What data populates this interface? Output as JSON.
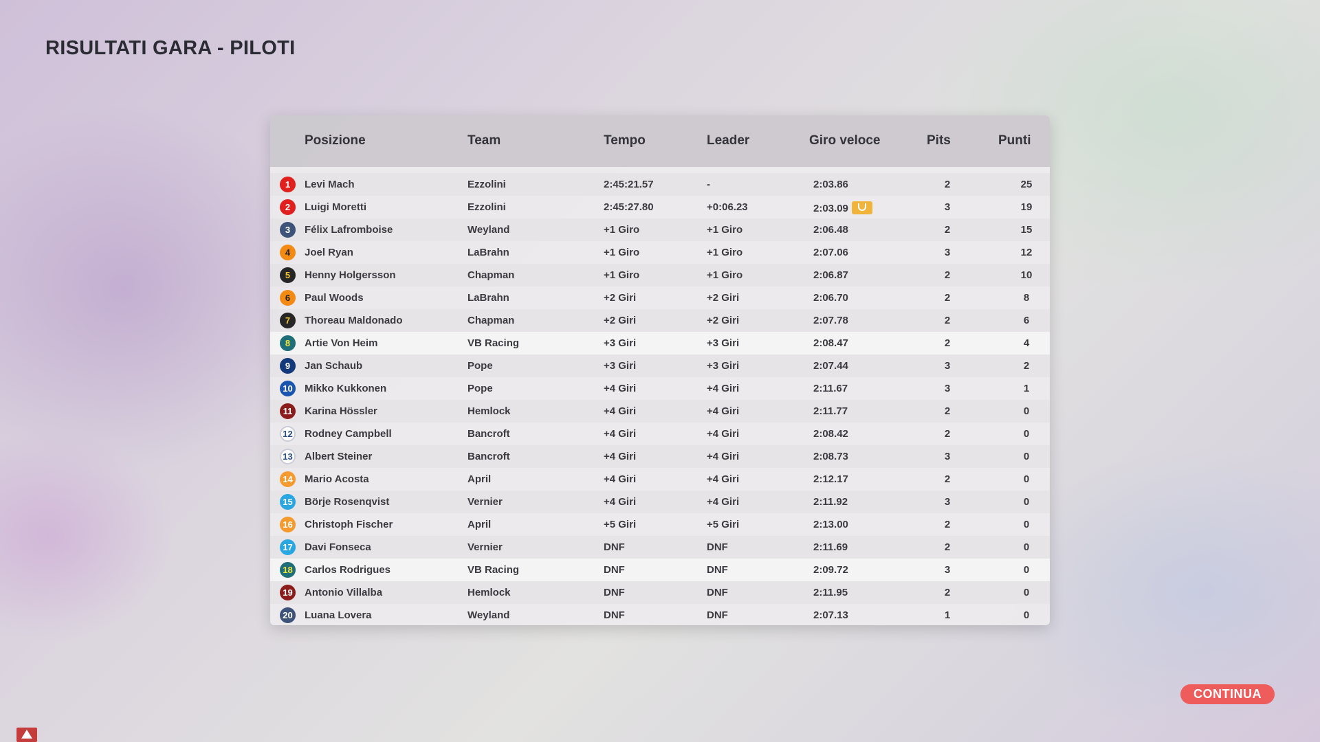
{
  "page": {
    "title": "RISULTATI GARA - PILOTI"
  },
  "table": {
    "headers": {
      "position": "Posizione",
      "team": "Team",
      "time": "Tempo",
      "leader": "Leader",
      "fastest_lap": "Giro veloce",
      "pits": "Pits",
      "points": "Punti"
    },
    "highlighted_rows": [
      8,
      18
    ],
    "rows": [
      {
        "pos": "1",
        "name": "Levi Mach",
        "team": "Ezzolini",
        "time": "2:45:21.57",
        "leader": "-",
        "fastest": "2:03.86",
        "pits": "2",
        "points": "25",
        "badge_bg": "#e0201e",
        "badge_fg": "#ffffff",
        "badge_border": "#e0201e"
      },
      {
        "pos": "2",
        "name": "Luigi Moretti",
        "team": "Ezzolini",
        "time": "2:45:27.80",
        "leader": "+0:06.23",
        "fastest": "2:03.09",
        "fastest_lap_icon": "trophy-icon",
        "pits": "3",
        "points": "19",
        "badge_bg": "#e0201e",
        "badge_fg": "#ffffff",
        "badge_border": "#e0201e"
      },
      {
        "pos": "3",
        "name": "Félix Lafromboise",
        "team": "Weyland",
        "time": "+1 Giro",
        "leader": "+1 Giro",
        "fastest": "2:06.48",
        "pits": "2",
        "points": "15",
        "badge_bg": "#3d5379",
        "badge_fg": "#ffffff",
        "badge_border": "#3d5379"
      },
      {
        "pos": "4",
        "name": "Joel Ryan",
        "team": "LaBrahn",
        "time": "+1 Giro",
        "leader": "+1 Giro",
        "fastest": "2:07.06",
        "pits": "3",
        "points": "12",
        "badge_bg": "#f28a14",
        "badge_fg": "#1e1e1e",
        "badge_border": "#f28a14"
      },
      {
        "pos": "5",
        "name": "Henny Holgersson",
        "team": "Chapman",
        "time": "+1 Giro",
        "leader": "+1 Giro",
        "fastest": "2:06.87",
        "pits": "2",
        "points": "10",
        "badge_bg": "#262626",
        "badge_fg": "#f2c230",
        "badge_border": "#262626"
      },
      {
        "pos": "6",
        "name": "Paul Woods",
        "team": "LaBrahn",
        "time": "+2 Giri",
        "leader": "+2 Giri",
        "fastest": "2:06.70",
        "pits": "2",
        "points": "8",
        "badge_bg": "#f28a14",
        "badge_fg": "#1e1e1e",
        "badge_border": "#f28a14"
      },
      {
        "pos": "7",
        "name": "Thoreau Maldonado",
        "team": "Chapman",
        "time": "+2 Giri",
        "leader": "+2 Giri",
        "fastest": "2:07.78",
        "pits": "2",
        "points": "6",
        "badge_bg": "#262626",
        "badge_fg": "#f2c230",
        "badge_border": "#262626"
      },
      {
        "pos": "8",
        "name": "Artie Von Heim",
        "team": "VB Racing",
        "time": "+3 Giri",
        "leader": "+3 Giri",
        "fastest": "2:08.47",
        "pits": "2",
        "points": "4",
        "badge_bg": "#1e6f78",
        "badge_fg": "#f2e23c",
        "badge_border": "#1e6f78"
      },
      {
        "pos": "9",
        "name": "Jan Schaub",
        "team": "Pope",
        "time": "+3 Giri",
        "leader": "+3 Giri",
        "fastest": "2:07.44",
        "pits": "3",
        "points": "2",
        "badge_bg": "#13397a",
        "badge_fg": "#ffffff",
        "badge_border": "#13397a"
      },
      {
        "pos": "10",
        "name": "Mikko Kukkonen",
        "team": "Pope",
        "time": "+4 Giri",
        "leader": "+4 Giri",
        "fastest": "2:11.67",
        "pits": "3",
        "points": "1",
        "badge_bg": "#1a56b0",
        "badge_fg": "#ffffff",
        "badge_border": "#1a56b0"
      },
      {
        "pos": "11",
        "name": "Karina Hössler",
        "team": "Hemlock",
        "time": "+4 Giri",
        "leader": "+4 Giri",
        "fastest": "2:11.77",
        "pits": "2",
        "points": "0",
        "badge_bg": "#8a1c1c",
        "badge_fg": "#ffffff",
        "badge_border": "#8a1c1c"
      },
      {
        "pos": "12",
        "name": "Rodney Campbell",
        "team": "Bancroft",
        "time": "+4 Giri",
        "leader": "+4 Giri",
        "fastest": "2:08.42",
        "pits": "2",
        "points": "0",
        "badge_bg": "#ffffff",
        "badge_fg": "#2a4f8a",
        "badge_border": "#c9ccd6"
      },
      {
        "pos": "13",
        "name": "Albert Steiner",
        "team": "Bancroft",
        "time": "+4 Giri",
        "leader": "+4 Giri",
        "fastest": "2:08.73",
        "pits": "3",
        "points": "0",
        "badge_bg": "#ffffff",
        "badge_fg": "#2a4f8a",
        "badge_border": "#c9ccd6"
      },
      {
        "pos": "14",
        "name": "Mario Acosta",
        "team": "April",
        "time": "+4 Giri",
        "leader": "+4 Giri",
        "fastest": "2:12.17",
        "pits": "2",
        "points": "0",
        "badge_bg": "#f59a2e",
        "badge_fg": "#ffffff",
        "badge_border": "#f59a2e"
      },
      {
        "pos": "15",
        "name": "Börje Rosenqvist",
        "team": "Vernier",
        "time": "+4 Giri",
        "leader": "+4 Giri",
        "fastest": "2:11.92",
        "pits": "3",
        "points": "0",
        "badge_bg": "#2aa6e0",
        "badge_fg": "#ffffff",
        "badge_border": "#2aa6e0"
      },
      {
        "pos": "16",
        "name": "Christoph Fischer",
        "team": "April",
        "time": "+5 Giri",
        "leader": "+5 Giri",
        "fastest": "2:13.00",
        "pits": "2",
        "points": "0",
        "badge_bg": "#f59a2e",
        "badge_fg": "#ffffff",
        "badge_border": "#f59a2e"
      },
      {
        "pos": "17",
        "name": "Davi Fonseca",
        "team": "Vernier",
        "time": "DNF",
        "leader": "DNF",
        "fastest": "2:11.69",
        "pits": "2",
        "points": "0",
        "badge_bg": "#2aa6e0",
        "badge_fg": "#ffffff",
        "badge_border": "#2aa6e0"
      },
      {
        "pos": "18",
        "name": "Carlos Rodrigues",
        "team": "VB Racing",
        "time": "DNF",
        "leader": "DNF",
        "fastest": "2:09.72",
        "pits": "3",
        "points": "0",
        "badge_bg": "#1e6f78",
        "badge_fg": "#f2e23c",
        "badge_border": "#1e6f78"
      },
      {
        "pos": "19",
        "name": "Antonio Villalba",
        "team": "Hemlock",
        "time": "DNF",
        "leader": "DNF",
        "fastest": "2:11.95",
        "pits": "2",
        "points": "0",
        "badge_bg": "#8a1c1c",
        "badge_fg": "#ffffff",
        "badge_border": "#8a1c1c"
      },
      {
        "pos": "20",
        "name": "Luana Lovera",
        "team": "Weyland",
        "time": "DNF",
        "leader": "DNF",
        "fastest": "2:07.13",
        "pits": "1",
        "points": "0",
        "badge_bg": "#3d5379",
        "badge_fg": "#ffffff",
        "badge_border": "#3d5379"
      }
    ]
  },
  "actions": {
    "continue_label": "CONTINUA"
  },
  "status": {
    "warning_icon": "warning-icon"
  },
  "colors": {
    "accent": "#ee5c5c",
    "fastest_lap_badge": "#f1b43a"
  }
}
